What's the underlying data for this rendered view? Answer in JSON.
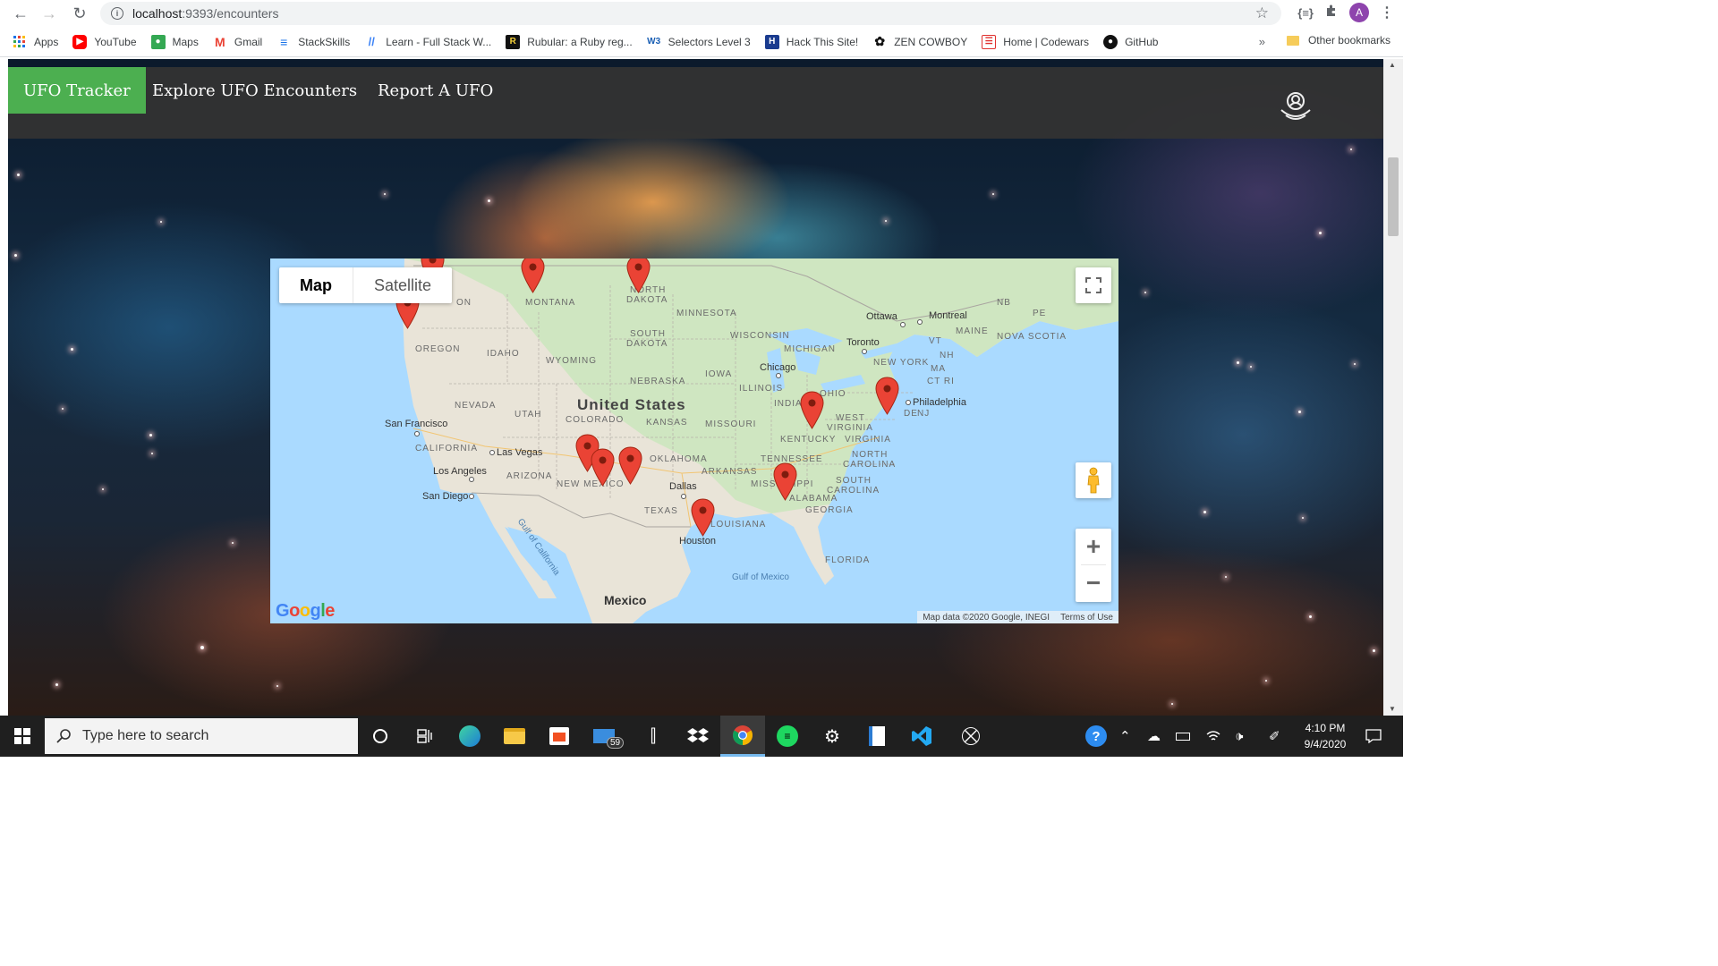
{
  "browser": {
    "url_host": "localhost",
    "url_rest": ":9393/encounters",
    "profile_initial": "A",
    "bookmarks": [
      "Apps",
      "YouTube",
      "Maps",
      "Gmail",
      "StackSkills",
      "Learn - Full Stack W...",
      "Rubular: a Ruby reg...",
      "Selectors Level 3",
      "Hack This Site!",
      "ZEN COWBOY",
      "Home | Codewars",
      "GitHub"
    ],
    "bookmark_more": "»",
    "other_bookmarks": "Other bookmarks",
    "extension_label": "{≡}"
  },
  "app": {
    "brand": "UFO Tracker",
    "nav": [
      "Explore UFO Encounters",
      "Report A UFO"
    ]
  },
  "map": {
    "type_options": [
      "Map",
      "Satellite"
    ],
    "country": "United States",
    "mexico": "Mexico",
    "states": [
      "MONTANA",
      "NORTH",
      "DAKOTA",
      "MINNESOTA",
      "SOUTH",
      "DAKOTA",
      "OREGON",
      "IDAHO",
      "WYOMING",
      "NEBRASKA",
      "IOWA",
      "NEVADA",
      "UTAH",
      "COLORADO",
      "KANSAS",
      "MISSOURI",
      "CALIFORNIA",
      "ARIZONA",
      "NEW MEXICO",
      "OKLAHOMA",
      "ARKANSAS",
      "TEXAS",
      "LOUISIANA",
      "MISSISSIPPI",
      "ALABAMA",
      "GEORGIA",
      "TENNESSEE",
      "KENTUCKY",
      "WISCONSIN",
      "MICHIGAN",
      "ILLINOIS",
      "INDIANA",
      "OHIO",
      "WEST",
      "VIRGINIA",
      "VIRGINIA",
      "NORTH",
      "CAROLINA",
      "SOUTH",
      "CAROLINA",
      "FLORIDA",
      "NEW YORK",
      "MAINE",
      "VT",
      "NH",
      "MA",
      "CT RI",
      "NB",
      "PE",
      "NOVA SCOTIA",
      "DE",
      "NJ",
      "ON"
    ],
    "cities": [
      "San Francisco",
      "Las Vegas",
      "Los Angeles",
      "San Diego",
      "Dallas",
      "Houston",
      "Chicago",
      "Toronto",
      "Ottawa",
      "Montreal",
      "Philadelphia"
    ],
    "water": [
      "Gulf of California",
      "Gulf of Mexico"
    ],
    "google": "Google",
    "attribution": "Map data ©2020 Google, INEGI",
    "terms": "Terms of Use",
    "markers_count": 11
  },
  "taskbar": {
    "search_placeholder": "Type here to search",
    "mail_badge": "59",
    "time": "4:10 PM",
    "date": "9/4/2020"
  }
}
